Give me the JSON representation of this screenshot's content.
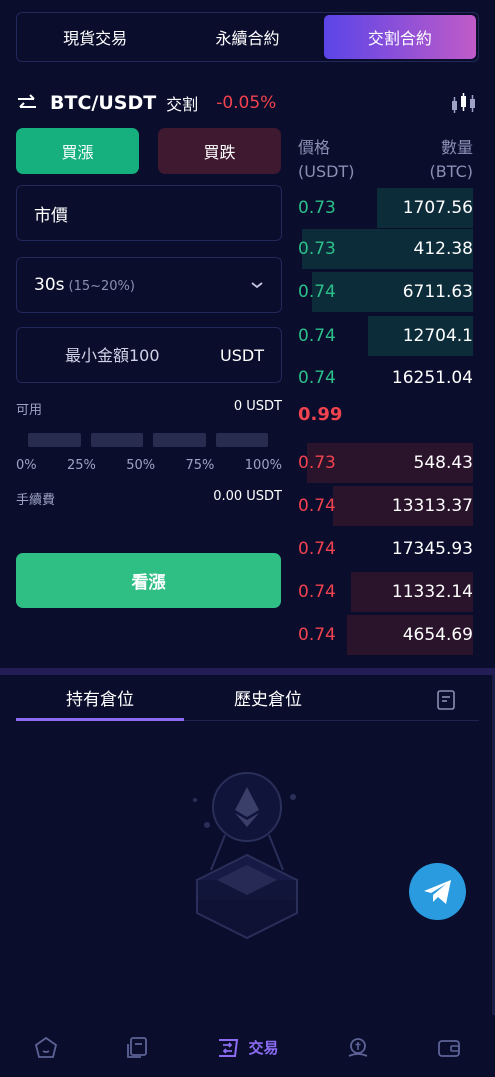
{
  "top_tabs": [
    {
      "label": "現貨交易",
      "active": false
    },
    {
      "label": "永續合約",
      "active": false
    },
    {
      "label": "交割合約",
      "active": true
    }
  ],
  "pair": {
    "swap_icon": "swap-arrows-icon",
    "name": "BTC/USDT",
    "type": "交割",
    "change": "-0.05%",
    "chart_icon": "candlestick-icon"
  },
  "trade": {
    "buy_label": "買漲",
    "sell_label": "買跌",
    "order_type": "市價",
    "time_main": "30s",
    "time_sub": "(15~20%)",
    "amount_placeholder": "最小金額100",
    "amount_unit": "USDT",
    "available_label": "可用",
    "available_value": "0 USDT",
    "slider_level": 0,
    "percents": [
      "0%",
      "25%",
      "50%",
      "75%",
      "100%"
    ],
    "fee_label": "手續費",
    "fee_value": "0.00 USDT",
    "submit_label": "看漲"
  },
  "orderbook": {
    "price_header": "價格",
    "price_unit": "(USDT)",
    "qty_header": "數量",
    "qty_unit": "(BTC)",
    "asks": [
      {
        "price": "0.73",
        "qty": "1707.56",
        "depth": 0.55
      },
      {
        "price": "0.73",
        "qty": "412.38",
        "depth": 0.98
      },
      {
        "price": "0.74",
        "qty": "6711.63",
        "depth": 0.92
      },
      {
        "price": "0.74",
        "qty": "12704.1",
        "depth": 0.6
      },
      {
        "price": "0.74",
        "qty": "16251.04",
        "depth": 0.0
      }
    ],
    "mid_price": "0.99",
    "bids": [
      {
        "price": "0.73",
        "qty": "548.43",
        "depth": 0.95
      },
      {
        "price": "0.74",
        "qty": "13313.37",
        "depth": 0.8
      },
      {
        "price": "0.74",
        "qty": "17345.93",
        "depth": 0.0
      },
      {
        "price": "0.74",
        "qty": "11332.14",
        "depth": 0.7
      },
      {
        "price": "0.74",
        "qty": "4654.69",
        "depth": 0.72
      }
    ]
  },
  "positions": {
    "tabs": [
      {
        "label": "持有倉位",
        "active": true
      },
      {
        "label": "歷史倉位",
        "active": false
      }
    ],
    "doc_icon": "document-icon"
  },
  "bottom_nav": {
    "items": [
      "home-icon",
      "orders-icon",
      "trade-icon",
      "finance-icon",
      "wallet-icon"
    ],
    "active_label": "交易"
  },
  "colors": {
    "up": "#2cc08a",
    "down": "#f0434f",
    "accent": "#8c6cf2",
    "background": "#0a0d2c"
  }
}
